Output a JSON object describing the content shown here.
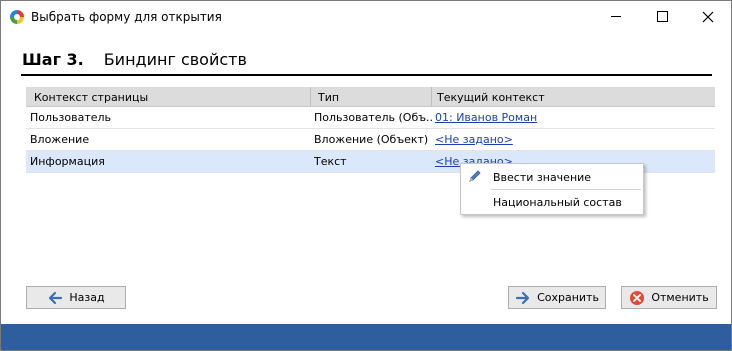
{
  "window": {
    "title": "Выбрать форму для открытия"
  },
  "heading": {
    "step": "Шаг 3.",
    "title": "Биндинг свойств"
  },
  "table": {
    "headers": [
      "Контекст страницы",
      "Тип",
      "Текущий контекст"
    ],
    "rows": [
      {
        "context": "Пользователь",
        "type": "Пользователь (Объ...",
        "current": "01: Иванов Роман",
        "selected": false
      },
      {
        "context": "Вложение",
        "type": "Вложение (Объект)",
        "current": "<Не задано>",
        "selected": false
      },
      {
        "context": "Информация",
        "type": "Текст",
        "current": "<Не задано>",
        "selected": true
      }
    ]
  },
  "context_menu": {
    "items": [
      {
        "label": "Ввести значение",
        "icon": "pencil-icon"
      },
      {
        "label": "Национальный состав",
        "icon": ""
      }
    ]
  },
  "buttons": {
    "back": {
      "label": "Назад",
      "icon": "arrow-left-icon"
    },
    "save": {
      "label": "Сохранить",
      "icon": "arrow-right-icon"
    },
    "cancel": {
      "label": "Отменить",
      "icon": "cancel-icon"
    }
  },
  "colors": {
    "accent": "#2f5e9e",
    "link": "#1a3fb5",
    "selected_row": "#dbe8fb",
    "cancel_red": "#e04a3a"
  }
}
